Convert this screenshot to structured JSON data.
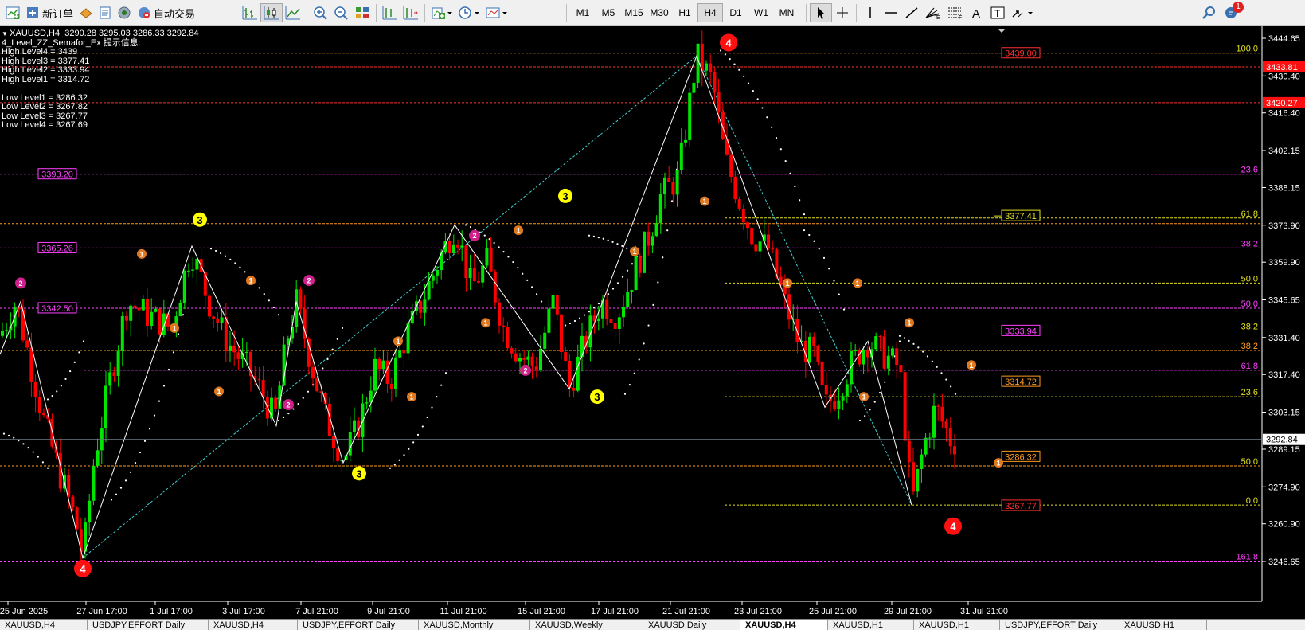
{
  "toolbar": {
    "new_order_label": "新订单",
    "auto_trading_label": "自动交易",
    "timeframes": [
      "M1",
      "M5",
      "M15",
      "M30",
      "H1",
      "H4",
      "D1",
      "W1",
      "MN"
    ],
    "active_timeframe": "H4",
    "notification_count": "1",
    "icons": [
      "new-chart-icon",
      "new-order-icon",
      "market-watch-icon",
      "data-window-icon",
      "navigator-icon",
      "auto-trading-icon",
      "bar-chart-icon",
      "candlestick-icon",
      "line-chart-icon",
      "zoom-in-icon",
      "zoom-out-icon",
      "tile-windows-icon",
      "chart-shift-icon",
      "autoscroll-icon",
      "indicators-icon",
      "periods-icon",
      "templates-icon",
      "cursor-icon",
      "crosshair-icon",
      "vertical-line-icon",
      "horizontal-line-icon",
      "trendline-icon",
      "fibonacci-fan-icon",
      "fibonacci-retracement-icon",
      "text-icon",
      "text-label-icon",
      "arrows-icon",
      "search-icon",
      "notifications-icon"
    ]
  },
  "chart_info": {
    "header": "XAUUSD,H4  3290.28 3295.03 3286.33 3292.84",
    "indicator_title": "4_Level_ZZ_Semafor_Ex 提示信息:",
    "lines": [
      "High Level4 = 3439",
      "High Level3 = 3377.41",
      "High Level2 = 3333.94",
      "High Level1 = 3314.72",
      "",
      "Low Level1 = 3286.32",
      "Low Level2 = 3267.82",
      "Low Level3 = 3267.77",
      "Low Level4 = 3267.69"
    ]
  },
  "price_axis": {
    "ticks": [
      "3444.65",
      "3430.40",
      "3416.40",
      "3402.15",
      "3388.15",
      "3373.90",
      "3359.90",
      "3345.65",
      "3331.40",
      "3317.40",
      "3303.15",
      "3289.15",
      "3274.90",
      "3260.90",
      "3246.65"
    ],
    "current_price": "3292.84",
    "marker_red_1": "3433.81",
    "marker_red_2": "3420.27"
  },
  "time_axis": {
    "labels": [
      "25 Jun 2025",
      "27 Jun 17:00",
      "1 Jul 17:00",
      "3 Jul 17:00",
      "7 Jul 21:00",
      "9 Jul 21:00",
      "11 Jul 21:00",
      "15 Jul 21:00",
      "17 Jul 21:00",
      "21 Jul 21:00",
      "23 Jul 21:00",
      "25 Jul 21:00",
      "29 Jul 21:00",
      "31 Jul 21:00"
    ]
  },
  "level_labels": {
    "left_3393": "3393.20",
    "left_3365": "3365.26",
    "left_3342": "3342.50",
    "right_3439": "3439.00",
    "right_3377": "3377.41",
    "right_3333": "3333.94",
    "right_3314": "3314.72",
    "right_3286": "3286.32",
    "right_3267": "3267.77"
  },
  "fib_labels": {
    "f100": "100.0",
    "f236a": "23.6",
    "f618a": "61.8",
    "f382a": "38.2",
    "f500a": "50.0",
    "f500b": "50.0",
    "f382b": "38.2",
    "f382c": "38.2",
    "f618b": "61.8",
    "f236b": "23.6",
    "f500c": "50.0",
    "f00": "0.0",
    "f1618": "161.8"
  },
  "semafor_labels": [
    "1",
    "2",
    "3",
    "4"
  ],
  "tabs": [
    "XAUUSD,H4",
    "USDJPY,EFFORT Daily",
    "XAUUSD,H4",
    "USDJPY,EFFORT Daily",
    "XAUUSD,Monthly",
    "XAUUSD,Weekly",
    "XAUUSD,Daily",
    "XAUUSD,H4",
    "XAUUSD,H1",
    "XAUUSD,H1",
    "USDJPY,EFFORT Daily",
    "XAUUSD,H1"
  ],
  "active_tab": 7,
  "colors": {
    "background": "#000000",
    "bull": "#00e600",
    "bear": "#ff0000",
    "zigzag": "#ffffff",
    "semafor1": "#e07820",
    "semafor2": "#d0208c",
    "semafor3": "#ffff00",
    "semafor4": "#ff1010",
    "magenta_level": "#ff40ff",
    "orange_level": "#ff9a20",
    "yellow_level": "#e0e020",
    "red_level": "#ff3030",
    "cyan_line": "#40d0d0"
  }
}
